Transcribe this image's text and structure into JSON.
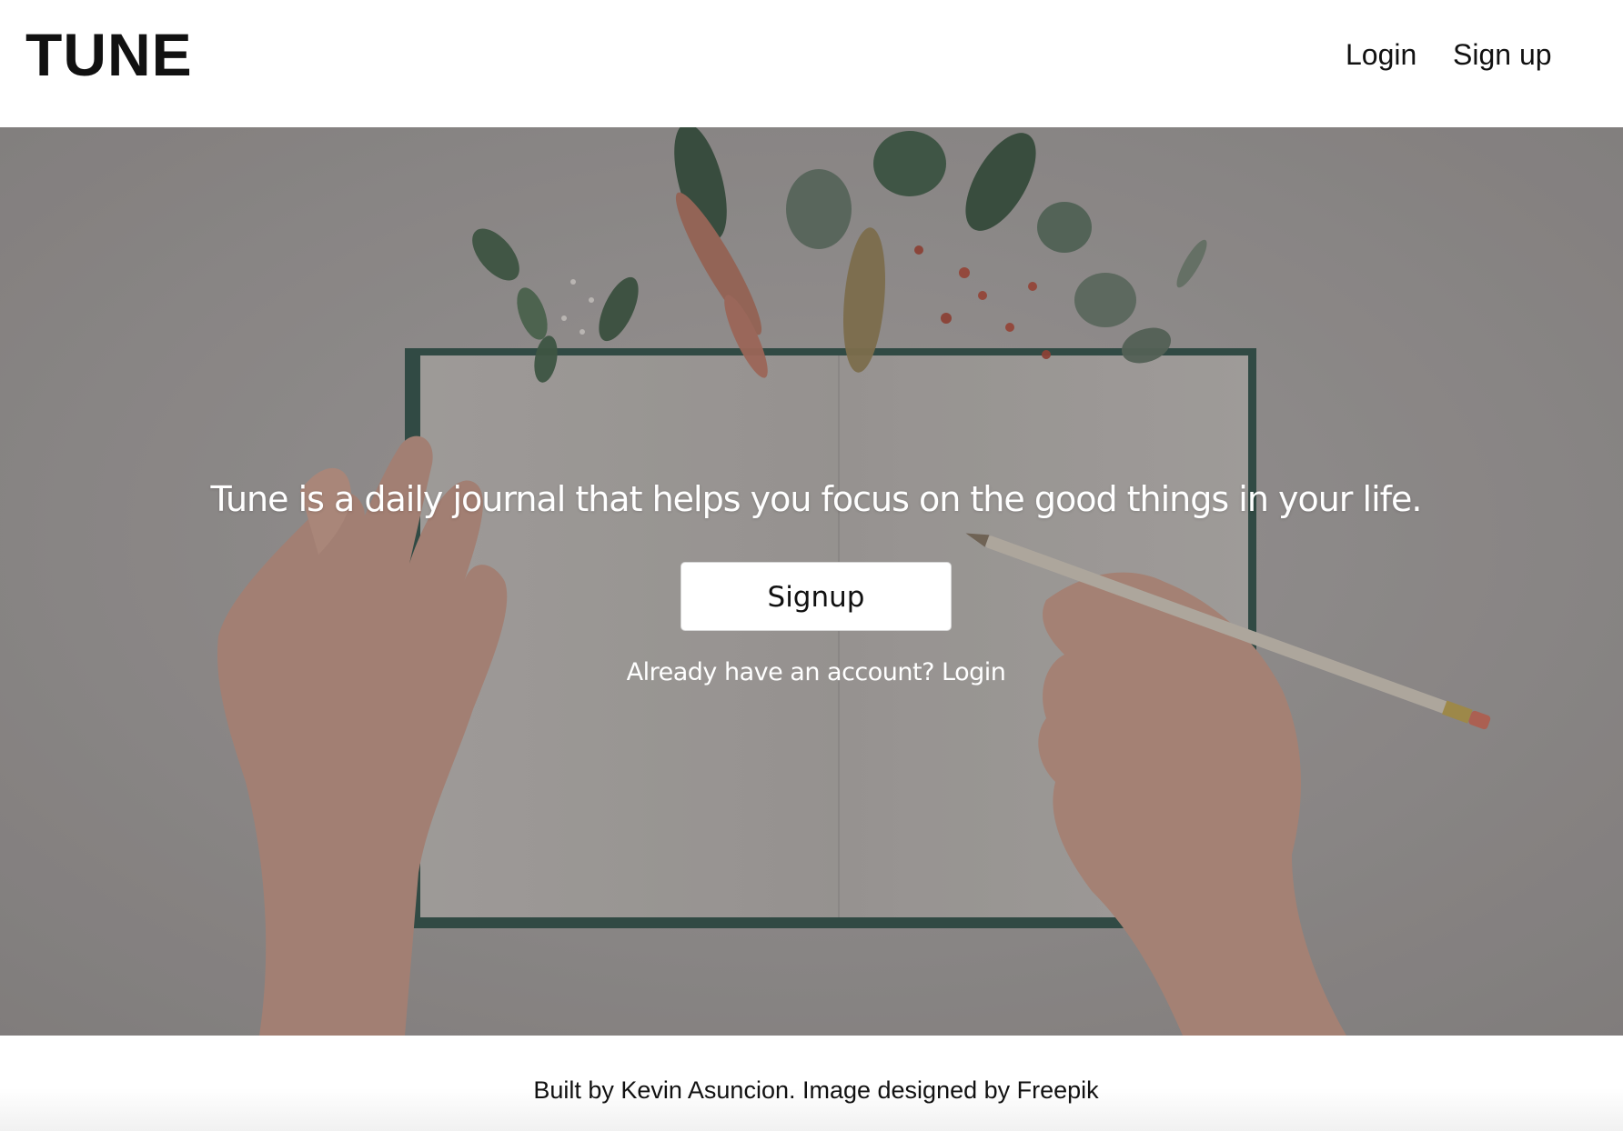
{
  "header": {
    "brand": "TUNE",
    "nav": [
      {
        "label": "Login"
      },
      {
        "label": "Sign up"
      }
    ]
  },
  "hero": {
    "tagline": "Tune is a daily journal that helps you focus on the good things in your life.",
    "signup_button": "Signup",
    "account_prompt": "Already have an account?",
    "login_link": "Login",
    "background_image": "open-notebook-with-flowers-hands-and-pencil"
  },
  "footer": {
    "credit": "Built by Kevin Asuncion. Image designed by Freepik"
  },
  "colors": {
    "text": "#111111",
    "hero_text": "#ffffff",
    "hero_overlay": "#8e8c8b",
    "notebook_cover": "#2f4f47"
  }
}
